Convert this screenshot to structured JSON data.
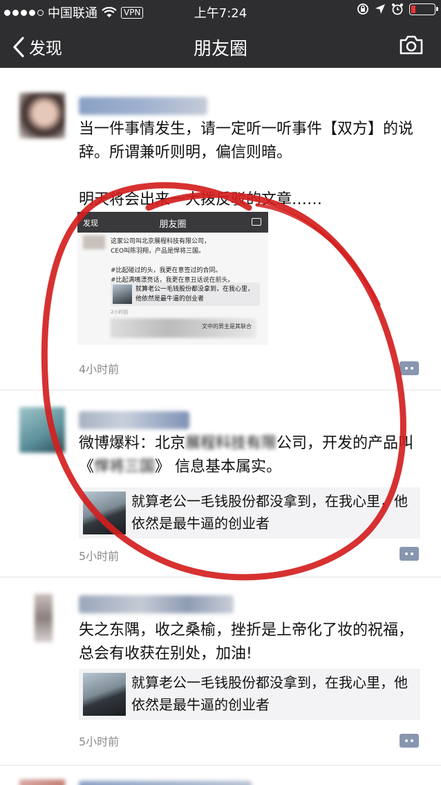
{
  "status_bar": {
    "carrier": "中国联通",
    "vpn": "VPN",
    "time": "上午7:24"
  },
  "nav": {
    "back_label": "发现",
    "title": "朋友圈",
    "camera_icon": "camera-icon"
  },
  "posts": [
    {
      "text": "当一件事情发生，请一定听一听事件【双方】的说辞。所谓兼听则明，偏信则暗。\n\n明天将会出来一大拨反驳的文章……",
      "embed": {
        "back": "发现",
        "title": "朋友圈",
        "body": "这家公司叫北京展程科技有限公司，\nCEO叫陈羽翔，产品是悍将三国。\n\n#比起碰过的头，我更在意签过的合同。\n#比起满嘴漂亮话，我更在意丑话说在前头。",
        "card_text": "就算老公一毛钱股份都没拿到，在我心里，他依然是最牛逼的创业者",
        "time": "2小时前",
        "footer": "文中的男主是其联合"
      },
      "time": "4小时前"
    },
    {
      "text": "微博爆料：北京",
      "text_blurred": "展程科技有限",
      "text_cont": "公司，开发的产品叫《",
      "text_blurred2": "悍将三国",
      "text_end": "》 信息基本属实。",
      "link_title": "就算老公一毛钱股份都没拿到，在我心里，他依然是最牛逼的创业者",
      "time": "5小时前"
    },
    {
      "text": "失之东隅，收之桑榆，挫折是上帝化了妆的祝福，总会有收获在别处，加油!",
      "link_title": "就算老公一毛钱股份都没拿到，在我心里，他依然是最牛逼的创业者",
      "time": "5小时前"
    }
  ],
  "colors": {
    "nav_bg": "#2e2e31",
    "time_gray": "#8a8a8a",
    "annotation_red": "#d42020",
    "comment_icon": "#8896b0"
  }
}
